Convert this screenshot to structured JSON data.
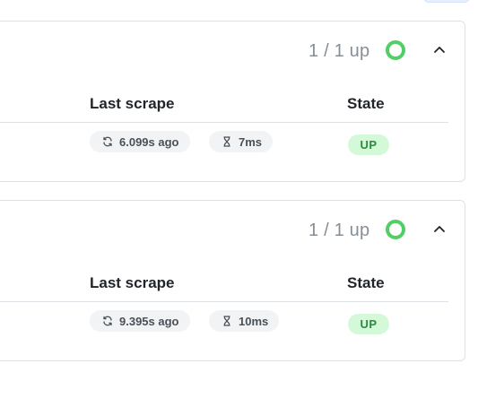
{
  "pools": [
    {
      "up_count": "1 / 1 up",
      "columns": {
        "last_scrape": "Last scrape",
        "state": "State"
      },
      "target": {
        "last_scrape": "6.099s ago",
        "duration": "7ms",
        "state": "UP"
      }
    },
    {
      "up_count": "1 / 1 up",
      "columns": {
        "last_scrape": "Last scrape",
        "state": "State"
      },
      "target": {
        "last_scrape": "9.395s ago",
        "duration": "10ms",
        "state": "UP"
      }
    }
  ],
  "icons": {
    "health": "status-ring-icon",
    "collapse": "chevron-up-icon",
    "last_scrape": "refresh-icon",
    "duration": "hourglass-icon"
  },
  "colors": {
    "health_ok": "#51cf66",
    "badge_up_bg": "#d3f9d8",
    "badge_up_text": "#2b8a3e",
    "pill_bg": "#f1f3f5",
    "muted_text": "#868e96",
    "border": "#dee2e6"
  }
}
